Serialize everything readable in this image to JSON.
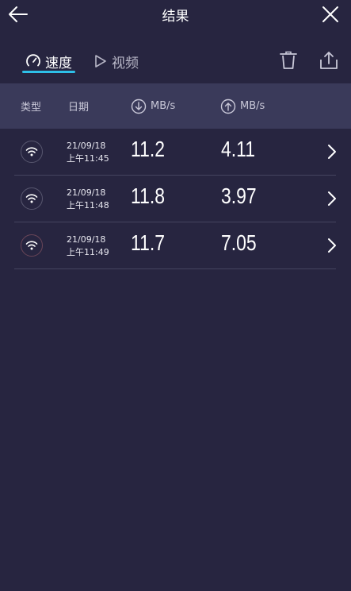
{
  "header": {
    "title": "结果",
    "back_icon": "arrow-left-icon",
    "close_icon": "close-icon"
  },
  "tabs": [
    {
      "label": "速度",
      "icon": "speedometer-icon",
      "active": true
    },
    {
      "label": "视频",
      "icon": "play-icon",
      "active": false
    }
  ],
  "actions": {
    "delete_icon": "trash-icon",
    "share_icon": "share-icon"
  },
  "table": {
    "columns": {
      "type": "类型",
      "date": "日期",
      "download": "MB/s",
      "upload": "MB/s"
    },
    "rows": [
      {
        "connection": "wifi",
        "date": "21/09/18",
        "time": "上午11:45",
        "download": "11.2",
        "upload": "4.11",
        "icon_color": "#ffffff"
      },
      {
        "connection": "wifi",
        "date": "21/09/18",
        "time": "上午11:48",
        "download": "11.8",
        "upload": "3.97",
        "icon_color": "#ffffff"
      },
      {
        "connection": "wifi",
        "date": "21/09/18",
        "time": "上午11:49",
        "download": "11.7",
        "upload": "7.05",
        "icon_color": "#ffffff"
      }
    ]
  },
  "colors": {
    "background": "#272540",
    "header_row": "#3a3a5a",
    "accent": "#2ec0e8",
    "divider": "#45445f"
  }
}
